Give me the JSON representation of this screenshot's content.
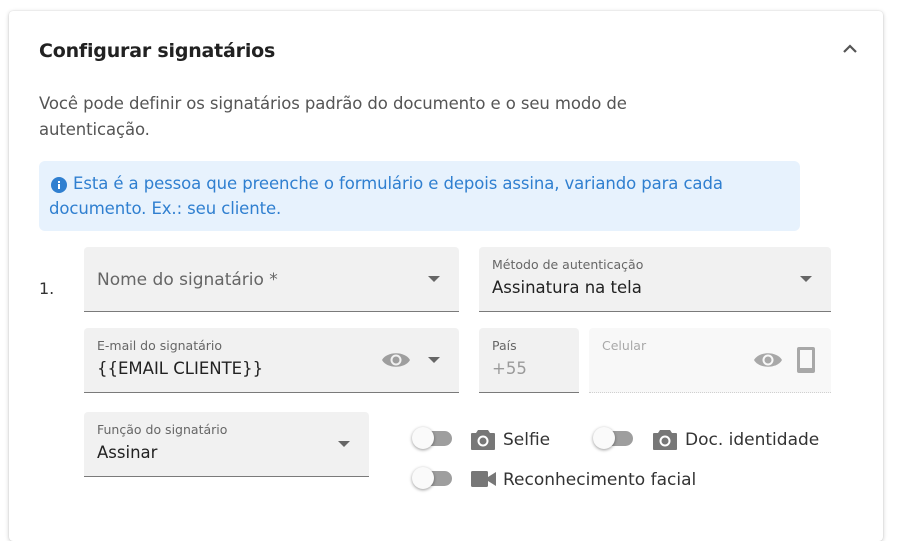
{
  "section": {
    "title": "Configurar signatários",
    "description": "Você pode definir os signatários padrão do documento e o seu modo de autenticação.",
    "info": "Esta é a pessoa que preenche o formulário e depois assina, variando para cada documento. Ex.: seu cliente.",
    "collapse_icon": "chevron-up-icon"
  },
  "signer": {
    "index": "1.",
    "name_field": {
      "placeholder": "Nome do signatário *"
    },
    "auth_method": {
      "label": "Método de autenticação",
      "value": "Assinatura na tela"
    },
    "email": {
      "label": "E-mail do signatário",
      "value": "{{EMAIL CLIENTE}}",
      "icon": "eye-icon"
    },
    "country": {
      "label": "País",
      "value": "+55"
    },
    "phone": {
      "label": "Celular",
      "icons": [
        "eye-icon",
        "smartphone-icon"
      ]
    },
    "role": {
      "label": "Função do signatário",
      "value": "Assinar"
    },
    "options": [
      {
        "label": "Selfie",
        "icon": "camera-icon",
        "enabled": false
      },
      {
        "label": "Doc. identidade",
        "icon": "camera-icon",
        "enabled": false
      },
      {
        "label": "Reconhecimento facial",
        "icon": "videocam-icon",
        "enabled": false
      }
    ]
  },
  "colors": {
    "info_bg": "#e7f2fd",
    "info_text": "#2f7fd0",
    "field_bg": "#f1f1f1"
  }
}
